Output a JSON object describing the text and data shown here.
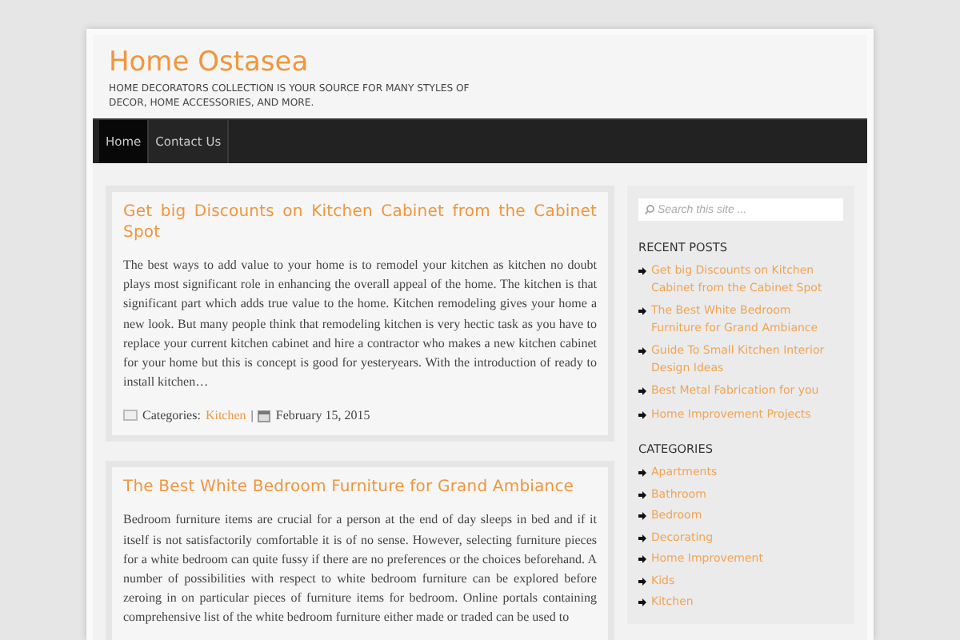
{
  "site": {
    "title": "Home Ostasea",
    "tagline": "HOME DECORATORS COLLECTION IS YOUR SOURCE FOR MANY STYLES OF DECOR, HOME ACCESSORIES, AND MORE."
  },
  "nav": [
    {
      "label": "Home",
      "selected": true
    },
    {
      "label": "Contact Us",
      "selected": false
    }
  ],
  "posts": [
    {
      "title": "Get big Discounts on Kitchen Cabinet from the Cabinet Spot",
      "excerpt": "The best ways to add value to your home is to remodel your kitchen as kitchen no doubt plays most significant role in enhancing the overall appeal of the home. The kitchen is that significant part which adds true value to the home. Kitchen remodeling gives your home a new look. But many people think that remodeling kitchen is very hectic task as you have to replace your current kitchen cabinet and hire a contractor who makes a new kitchen cabinet for your home but this is concept is good for yesteryears. With the introduction of ready to install kitchen…",
      "categories_label": "Categories:",
      "category": "Kitchen",
      "separator": "|",
      "date": "February 15, 2015"
    },
    {
      "title": "The Best White Bedroom Furniture for Grand Ambiance",
      "excerpt": "Bedroom furniture items are crucial for a person at the end of day sleeps in bed and if it itself is not satisfactorily comfortable it is of no sense. However, selecting furniture pieces for a white bedroom can quite fussy if there are no preferences or the choices beforehand. A number of possibilities with respect to white bedroom furniture can be explored before zeroing in on particular pieces of furniture items for bedroom. Online portals containing comprehensive list of the white bedroom furniture either made or traded can be used to"
    }
  ],
  "sidebar": {
    "search": {
      "placeholder": "Search this site ..."
    },
    "recent_posts": {
      "heading": "RECENT POSTS",
      "items": [
        "Get big Discounts on Kitchen Cabinet from the Cabinet Spot",
        "The Best White Bedroom Furniture for Grand Ambiance",
        "Guide To Small Kitchen Interior Design Ideas",
        "Best Metal Fabrication for you",
        "Home Improvement Projects"
      ]
    },
    "categories": {
      "heading": "CATEGORIES",
      "items": [
        "Apartments",
        "Bathroom",
        "Bedroom",
        "Decorating",
        "Home Improvement",
        "Kids",
        "Kitchen"
      ]
    }
  }
}
